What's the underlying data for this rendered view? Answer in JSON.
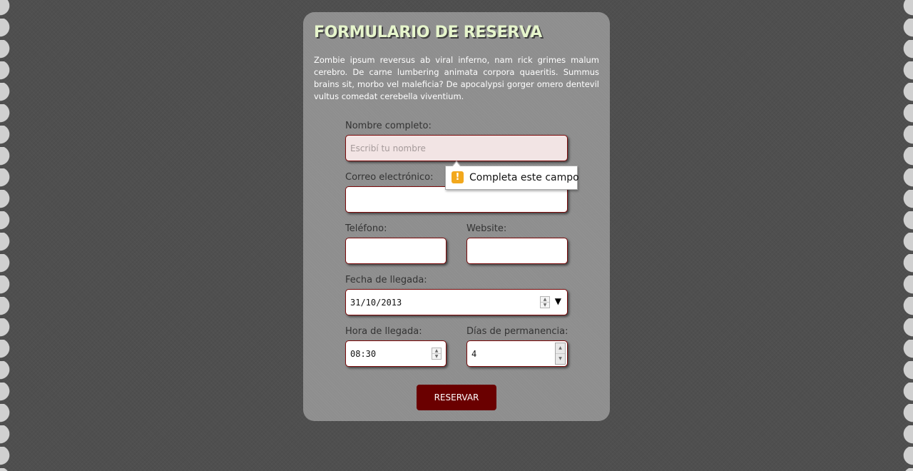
{
  "form": {
    "title": "FORMULARIO DE RESERVA",
    "intro": "Zombie ipsum reversus ab viral inferno, nam rick grimes malum cerebro. De carne lumbering animata corpora quaeritis. Summus brains sit, morbo vel maleficia? De apocalypsi gorger omero dentevil vultus comedat cerebella viventium.",
    "name": {
      "label": "Nombre completo:",
      "placeholder": "Escribí tu nombre",
      "value": ""
    },
    "email": {
      "label": "Correo electrónico:",
      "value": ""
    },
    "phone": {
      "label": "Teléfono:",
      "value": ""
    },
    "website": {
      "label": "Website:",
      "value": ""
    },
    "arrival_date": {
      "label": "Fecha de llegada:",
      "value": "31/10/2013"
    },
    "arrival_time": {
      "label": "Hora de llegada:",
      "value": "08:30"
    },
    "days": {
      "label": "Días de permanencia:",
      "value": "4"
    },
    "submit_label": "RESERVAR"
  },
  "validation_tooltip": {
    "message": "Completa este campo",
    "icon": "warning-icon"
  },
  "colors": {
    "background": "#4f4f4f",
    "card": "#8e8e8e",
    "title": "#e6f5cc",
    "field_border": "#7a0a0a",
    "button": "#6a0000",
    "warning": "#f2a81d"
  }
}
